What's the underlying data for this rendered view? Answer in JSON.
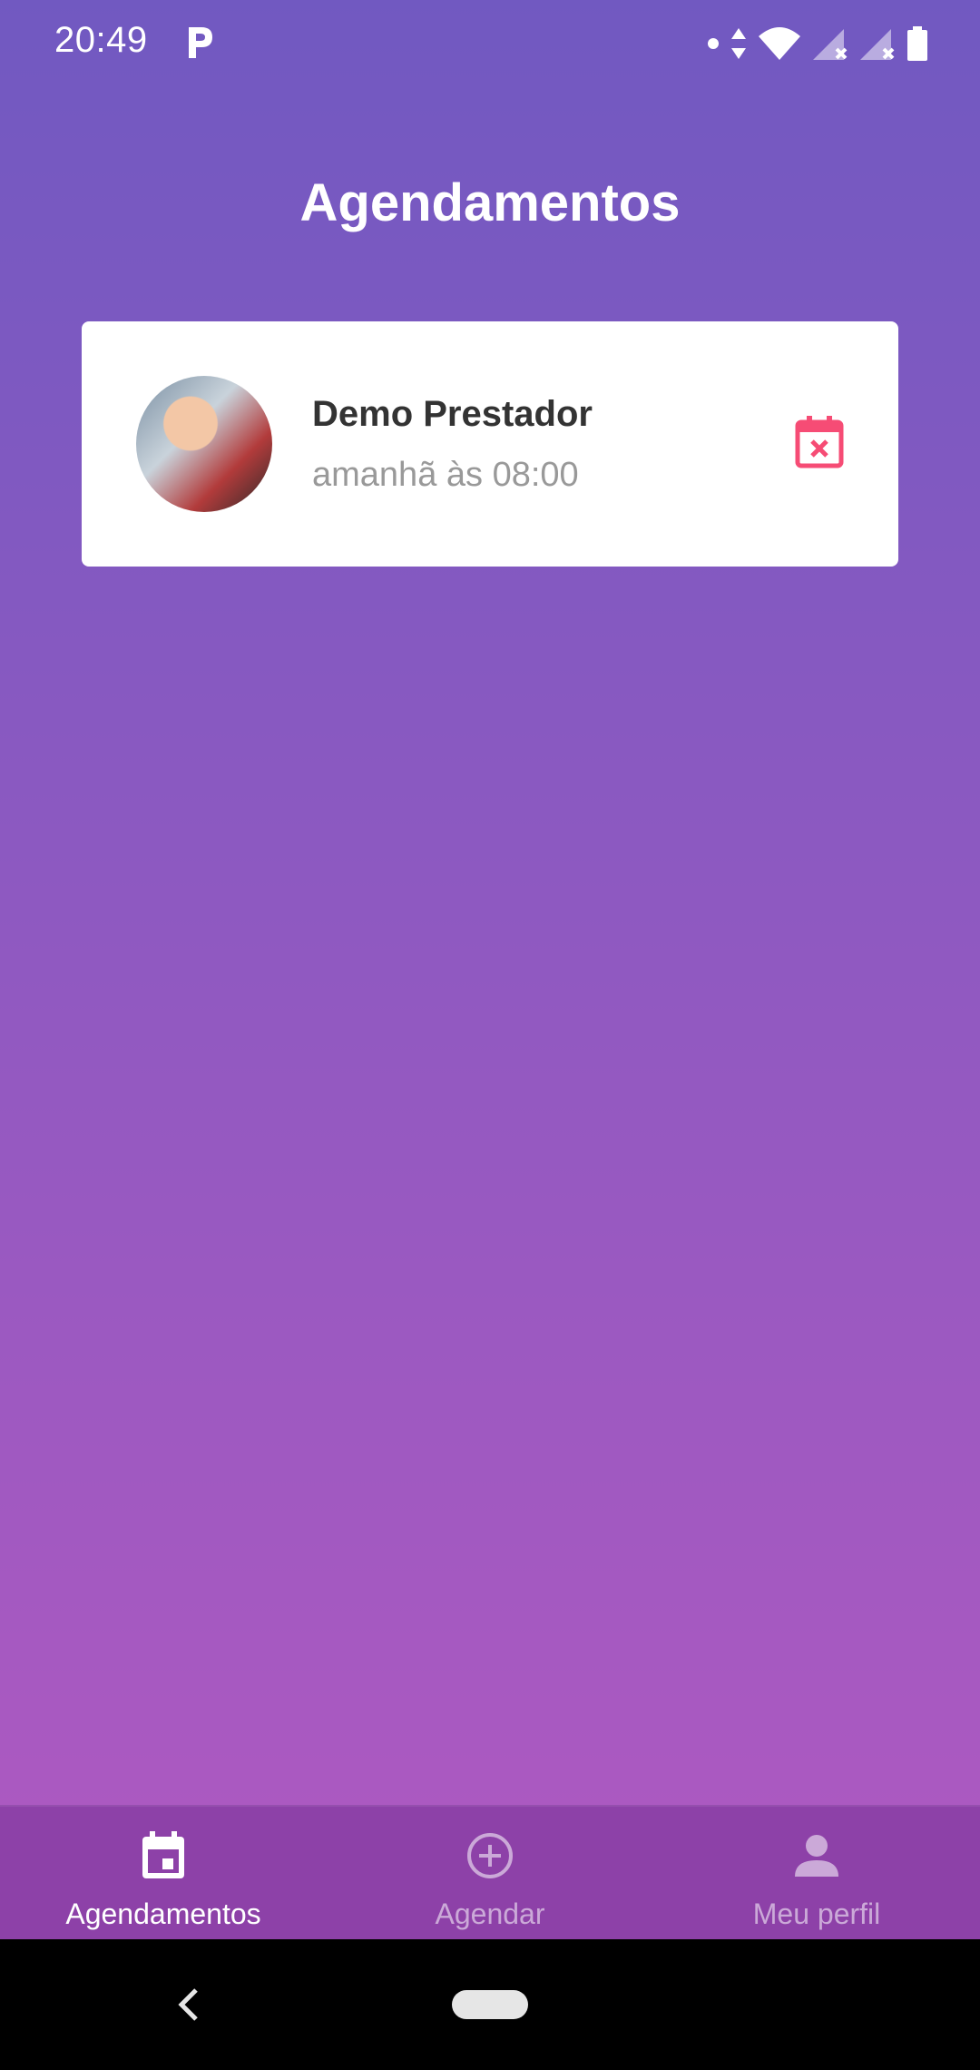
{
  "status_bar": {
    "time": "20:49",
    "icons": [
      "parking-app-icon",
      "dot-icon",
      "data-arrows-icon",
      "wifi-icon",
      "signal-icon",
      "signal-icon",
      "battery-icon"
    ]
  },
  "header": {
    "title": "Agendamentos"
  },
  "appointments": [
    {
      "provider_name": "Demo Prestador",
      "time_text": "amanhã às 08:00",
      "action_icon": "calendar-cancel-icon"
    }
  ],
  "tabs": [
    {
      "label": "Agendamentos",
      "icon": "calendar-icon",
      "active": true
    },
    {
      "label": "Agendar",
      "icon": "add-circle-icon",
      "active": false
    },
    {
      "label": "Meu perfil",
      "icon": "person-icon",
      "active": false
    }
  ],
  "colors": {
    "gradient_top": "#7159c1",
    "gradient_bottom": "#ab59c1",
    "cancel_accent": "#f64c75",
    "tabbar_bg": "#8d41a8"
  }
}
